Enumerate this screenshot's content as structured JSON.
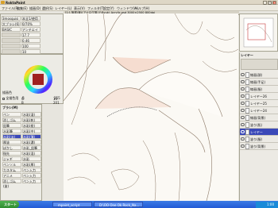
{
  "window": {
    "title": "RoktaPaint"
  },
  "menu": [
    "ファイル(F)",
    "編集(E)",
    "描画(D)",
    "選択(S)",
    "レイヤー(L)",
    "表示(V)",
    "フィルタ(T)",
    "設定(Y)",
    "ウィンドウ(W)",
    "ヘルプ(H)"
  ],
  "document_tab": "[1:]-落書(楽)[アナログ風] F:Ryuki_Acrylic.psd 3000×2500 800dpi",
  "top_info": {
    "rows": [
      {
        "k": "3mosquisi",
        "v": "本全1/使用量"
      },
      {
        "k": "大ブラシ(6)",
        "v": "0/70%"
      },
      {
        "k": "BASIC",
        "v": "アンチエイリア"
      },
      {
        "k": "",
        "v": "17.7"
      },
      {
        "k": "",
        "v": "0.46"
      },
      {
        "k": "",
        "v": "100"
      },
      {
        "k": "",
        "v": "10"
      }
    ]
  },
  "color_panel": {
    "values": [
      "255",
      "14",
      "201"
    ],
    "mode_label": "描画色",
    "checkbox_label": "全描色用"
  },
  "properties": {
    "header": "ブラシ(M)",
    "rows": [
      {
        "k": "ペン",
        "v": "水彩(湿)"
      },
      {
        "k": "消しゴム",
        "v": "水彩(乾)"
      },
      {
        "k": "鉛筆",
        "v": "水彩(極)"
      },
      {
        "k": "水彩筆",
        "v": "水彩(中)"
      },
      {
        "k": "水彩(淡)",
        "v": "水彩(薄)"
      },
      {
        "k": "厚塗",
        "v": "水彩(濃)"
      },
      {
        "k": "ぼかし",
        "v": "水彩_鉛筆"
      },
      {
        "k": "指先",
        "v": "水彩(混)"
      },
      {
        "k": "ジャギ",
        "v": "水彩"
      },
      {
        "k": "ペンソル(作)",
        "v": "水彩(厚)"
      },
      {
        "k": "カスタム",
        "v": "ペン入力"
      },
      {
        "k": "アニメ",
        "v": "ペン入力"
      },
      {
        "k": "消しゴム(塗)",
        "v": "ペン入力"
      }
    ]
  },
  "layers": {
    "header": "レイヤー",
    "items": [
      {
        "name": "線画(顔)"
      },
      {
        "name": "線画(手足)"
      },
      {
        "name": "線画(服)"
      },
      {
        "name": "レイヤー26"
      },
      {
        "name": "レイヤー25"
      },
      {
        "name": "レイヤー24"
      },
      {
        "name": "線画(背景)"
      },
      {
        "name": "塗り(肌)"
      },
      {
        "name": "レイヤー"
      },
      {
        "name": "塗り(服)"
      },
      {
        "name": "塗り(背景)"
      }
    ],
    "selected_index": 8
  },
  "taskbar": {
    "start": "スタート",
    "tasks": [
      "mpaint_script",
      "D:\\OO One Ok Rock_Na..."
    ],
    "clock": "1:00"
  },
  "colors": {
    "accent": "#3b49b8",
    "taskbar": "#225bd6",
    "start": "#3a9a3a"
  }
}
